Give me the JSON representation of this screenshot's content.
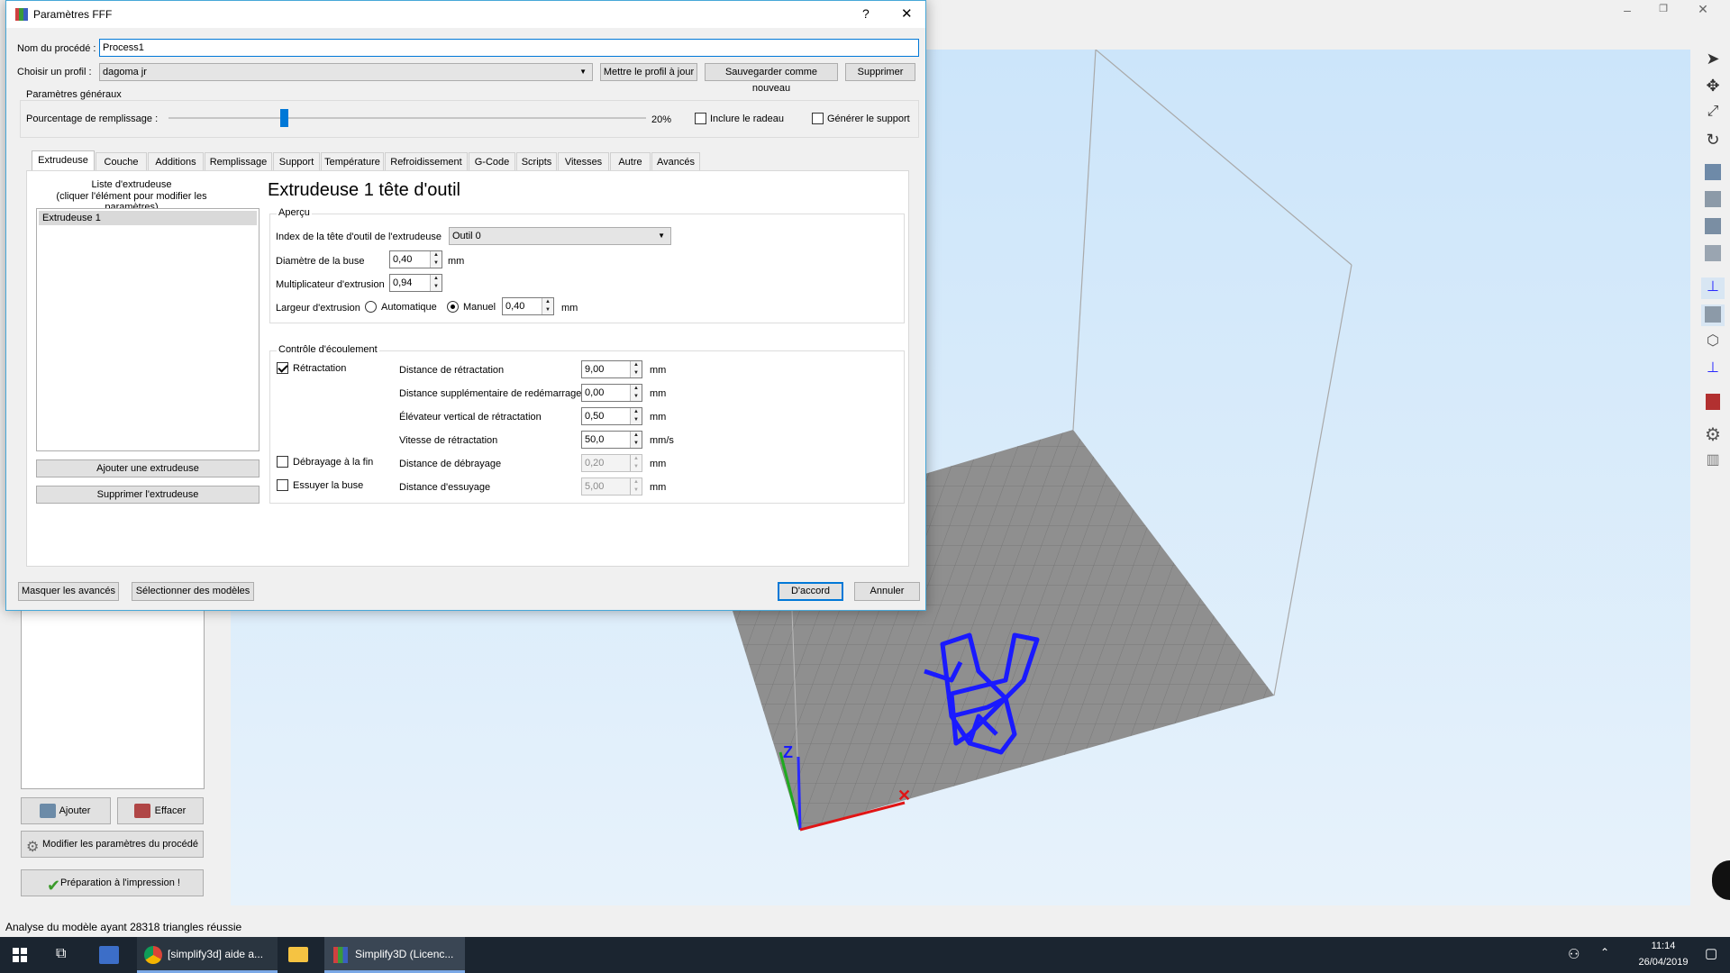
{
  "main_window": {
    "add_button": "Ajouter",
    "clear_button": "Effacer",
    "edit_process_button": "Modifier les paramètres du procédé",
    "prepare_button": "Préparation à l'impression !",
    "status_bar": "Analyse du modèle ayant 28318 triangles réussie",
    "axis_z": "Z",
    "axis_x": "X"
  },
  "dialog": {
    "title": "Paramètres FFF",
    "help_glyph": "?",
    "close_glyph": "✕",
    "process_name_label": "Nom du procédé :",
    "process_name_value": "Process1",
    "profile_label": "Choisir un profil :",
    "profile_value": "dagoma jr",
    "update_profile_button": "Mettre le profil à jour",
    "save_new_button": "Sauvegarder comme nouveau",
    "delete_button": "Supprimer",
    "general_group": "Paramètres généraux",
    "infill_label": "Pourcentage de remplissage :",
    "infill_value_text": "20%",
    "infill_fraction": 0.2,
    "raft_label": "Inclure le radeau",
    "support_label": "Générer le support",
    "tabs": [
      "Extrudeuse",
      "Couche",
      "Additions",
      "Remplissage",
      "Support",
      "Température",
      "Refroidissement",
      "G-Code",
      "Scripts",
      "Vitesses",
      "Autre",
      "Avancés"
    ],
    "extruder_list_header_1": "Liste d'extrudeuse",
    "extruder_list_header_2": "(cliquer l'élément pour modifier les paramètres)",
    "extruder_list_item": "Extrudeuse 1",
    "add_extruder_button": "Ajouter une extrudeuse",
    "remove_extruder_button": "Supprimer l'extrudeuse",
    "extruder_heading": "Extrudeuse 1 tête d'outil",
    "overview_group": "Aperçu",
    "tool_index_label": "Index de la tête d'outil de l'extrudeuse",
    "tool_index_value": "Outil 0",
    "nozzle_label": "Diamètre de la buse",
    "nozzle_value": "0,40",
    "mm": "mm",
    "mms": "mm/s",
    "multiplier_label": "Multiplicateur d'extrusion",
    "multiplier_value": "0,94",
    "width_label": "Largeur d'extrusion",
    "width_auto_label": "Automatique",
    "width_manual_label": "Manuel",
    "width_value": "0,40",
    "ooze_group": "Contrôle d'écoulement",
    "retraction_label": "Rétractation",
    "coast_label": "Débrayage à la fin",
    "wipe_label": "Essuyer la buse",
    "retract_distance_label": "Distance de rétractation",
    "retract_distance_value": "9,00",
    "extra_restart_label": "Distance supplémentaire de redémarrage",
    "extra_restart_value": "0,00",
    "lift_label": "Élévateur vertical de rétractation",
    "lift_value": "0,50",
    "retract_speed_label": "Vitesse de rétractation",
    "retract_speed_value": "50,0",
    "coast_distance_label": "Distance de débrayage",
    "coast_distance_value": "0,20",
    "wipe_distance_label": "Distance d'essuyage",
    "wipe_distance_value": "5,00",
    "hide_advanced_button": "Masquer les avancés",
    "select_models_button": "Sélectionner des modèles",
    "ok_button": "D'accord",
    "cancel_button": "Annuler"
  },
  "taskbar": {
    "chrome_label": "[simplify3d] aide a...",
    "simplify_label": "Simplify3D (Licenc...",
    "time": "11:14",
    "date": "26/04/2019"
  },
  "colors": {
    "accent": "#0078d7",
    "viewport_top": "#cde6fa",
    "bed": "#8a8a8a",
    "model": "#1a1aff",
    "taskbar": "#1b2530"
  }
}
